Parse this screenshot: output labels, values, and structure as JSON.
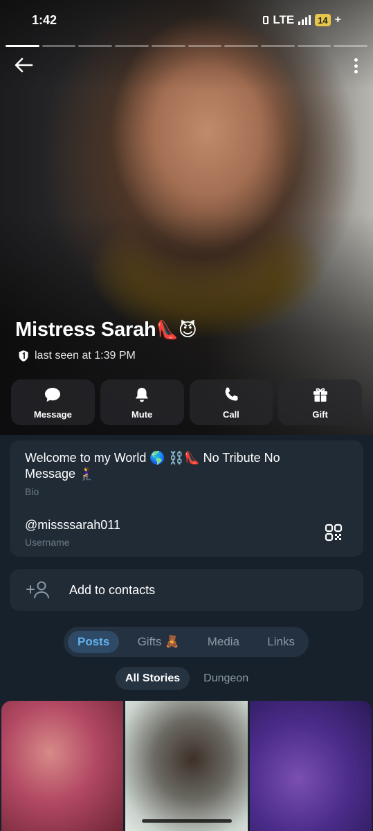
{
  "status_bar": {
    "time": "1:42",
    "network": "LTE",
    "battery": "14",
    "battery_suffix": "+"
  },
  "profile": {
    "name": "Mistress Sarah",
    "name_emojis": "👠😈",
    "last_seen": "last seen at 1:39 PM"
  },
  "actions": [
    {
      "label": "Message",
      "icon": "chat-bubble-icon"
    },
    {
      "label": "Mute",
      "icon": "bell-icon"
    },
    {
      "label": "Call",
      "icon": "phone-icon"
    },
    {
      "label": "Gift",
      "icon": "gift-icon"
    }
  ],
  "info": {
    "bio": "Welcome to my World 🌎 ⛓️👠 No Tribute No Message 🧎‍♀️",
    "bio_label": "Bio",
    "username": "@missssarah011",
    "username_label": "Username"
  },
  "add_contacts": {
    "label": "Add to contacts"
  },
  "tabs": [
    {
      "label": "Posts",
      "active": true
    },
    {
      "label": "Gifts 🧸",
      "active": false
    },
    {
      "label": "Media",
      "active": false
    },
    {
      "label": "Links",
      "active": false
    }
  ],
  "subtabs": [
    {
      "label": "All Stories",
      "active": true
    },
    {
      "label": "Dungeon",
      "active": false
    }
  ],
  "colors": {
    "background": "#17212b",
    "card": "#202b36",
    "accent": "#63b2f0",
    "muted_text": "#6f7c88"
  }
}
